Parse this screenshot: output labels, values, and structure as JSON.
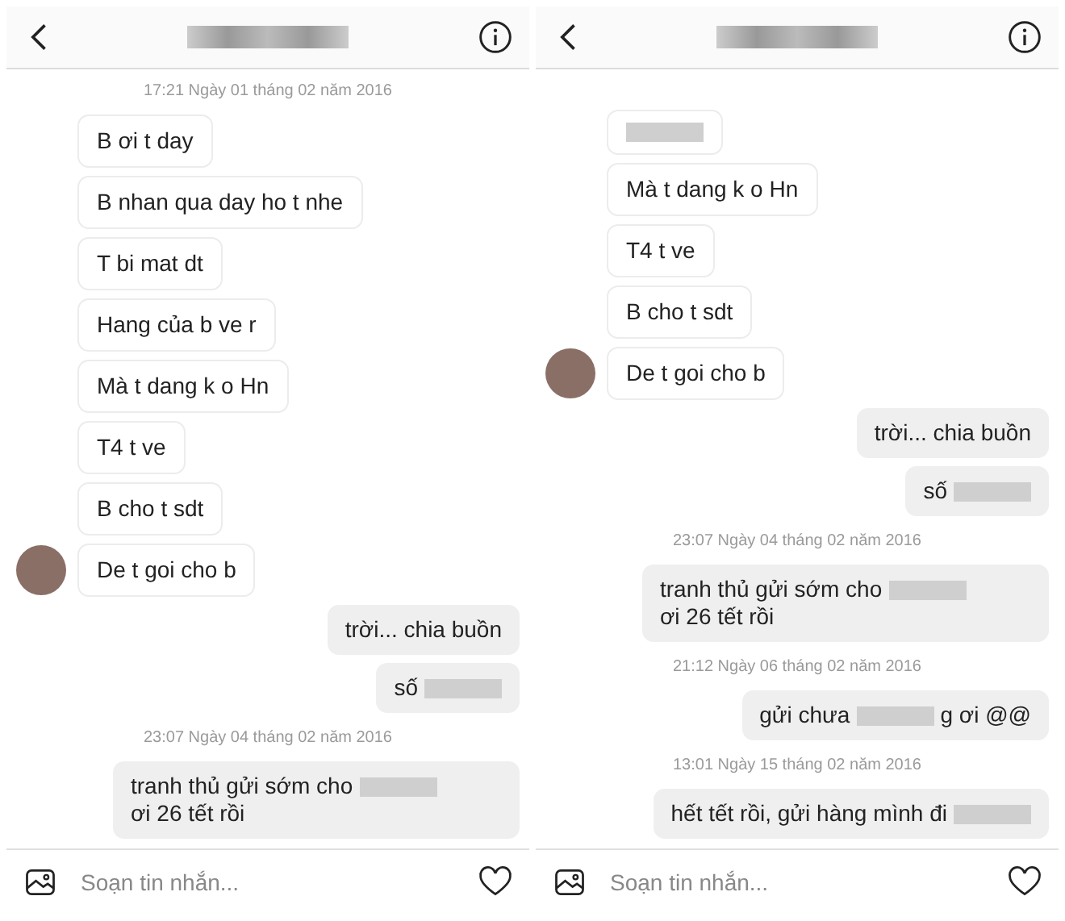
{
  "panels": [
    {
      "items": [
        {
          "kind": "time",
          "text": "17:21 Ngày 01 tháng 02 năm 2016"
        },
        {
          "kind": "received",
          "avatar": false,
          "parts": [
            {
              "kind": "text",
              "text": "B ơi t day"
            }
          ]
        },
        {
          "kind": "received",
          "avatar": false,
          "parts": [
            {
              "kind": "text",
              "text": "B nhan qua day ho t nhe"
            }
          ]
        },
        {
          "kind": "received",
          "avatar": false,
          "parts": [
            {
              "kind": "text",
              "text": "T bi mat dt"
            }
          ]
        },
        {
          "kind": "received",
          "avatar": false,
          "parts": [
            {
              "kind": "text",
              "text": "Hang của b ve r"
            }
          ]
        },
        {
          "kind": "received",
          "avatar": false,
          "parts": [
            {
              "kind": "text",
              "text": "Mà t dang k o Hn"
            }
          ]
        },
        {
          "kind": "received",
          "avatar": false,
          "parts": [
            {
              "kind": "text",
              "text": "T4 t ve"
            }
          ]
        },
        {
          "kind": "received",
          "avatar": false,
          "parts": [
            {
              "kind": "text",
              "text": "B cho t sdt"
            }
          ]
        },
        {
          "kind": "received",
          "avatar": true,
          "parts": [
            {
              "kind": "text",
              "text": "De t goi cho b"
            }
          ]
        },
        {
          "kind": "sent",
          "parts": [
            {
              "kind": "text",
              "text": "trời... chia buồn"
            }
          ]
        },
        {
          "kind": "sent",
          "parts": [
            {
              "kind": "text",
              "text": "số"
            },
            {
              "kind": "blur"
            }
          ]
        },
        {
          "kind": "time",
          "text": "23:07 Ngày 04 tháng 02 năm 2016"
        },
        {
          "kind": "sent",
          "parts": [
            {
              "kind": "text",
              "text": "tranh thủ gửi sớm cho"
            },
            {
              "kind": "blur"
            },
            {
              "kind": "br"
            },
            {
              "kind": "text",
              "text": "ơi 26 tết rồi"
            }
          ]
        }
      ],
      "composer": {
        "placeholder": "Soạn tin nhắn..."
      }
    },
    {
      "items": [
        {
          "kind": "received",
          "avatar": false,
          "parts": [
            {
              "kind": "blur"
            }
          ]
        },
        {
          "kind": "received",
          "avatar": false,
          "parts": [
            {
              "kind": "text",
              "text": "Mà t dang k o Hn"
            }
          ]
        },
        {
          "kind": "received",
          "avatar": false,
          "parts": [
            {
              "kind": "text",
              "text": "T4 t ve"
            }
          ]
        },
        {
          "kind": "received",
          "avatar": false,
          "parts": [
            {
              "kind": "text",
              "text": "B cho t sdt"
            }
          ]
        },
        {
          "kind": "received",
          "avatar": true,
          "parts": [
            {
              "kind": "text",
              "text": "De t goi cho b"
            }
          ]
        },
        {
          "kind": "sent",
          "parts": [
            {
              "kind": "text",
              "text": "trời... chia buồn"
            }
          ]
        },
        {
          "kind": "sent",
          "parts": [
            {
              "kind": "text",
              "text": "số"
            },
            {
              "kind": "blur"
            }
          ]
        },
        {
          "kind": "time",
          "text": "23:07 Ngày 04 tháng 02 năm 2016"
        },
        {
          "kind": "sent",
          "parts": [
            {
              "kind": "text",
              "text": "tranh thủ gửi sớm cho"
            },
            {
              "kind": "blur"
            },
            {
              "kind": "br"
            },
            {
              "kind": "text",
              "text": "ơi 26 tết rồi"
            }
          ]
        },
        {
          "kind": "time",
          "text": "21:12 Ngày 06 tháng 02 năm 2016"
        },
        {
          "kind": "sent",
          "parts": [
            {
              "kind": "text",
              "text": "gửi chưa"
            },
            {
              "kind": "blur"
            },
            {
              "kind": "text",
              "text": "g ơi @@"
            }
          ]
        },
        {
          "kind": "time",
          "text": "13:01 Ngày 15 tháng 02 năm 2016"
        },
        {
          "kind": "sent",
          "parts": [
            {
              "kind": "text",
              "text": "hết tết rồi, gửi hàng mình đi"
            },
            {
              "kind": "blur"
            }
          ]
        }
      ],
      "composer": {
        "placeholder": "Soạn tin nhắn..."
      }
    }
  ]
}
